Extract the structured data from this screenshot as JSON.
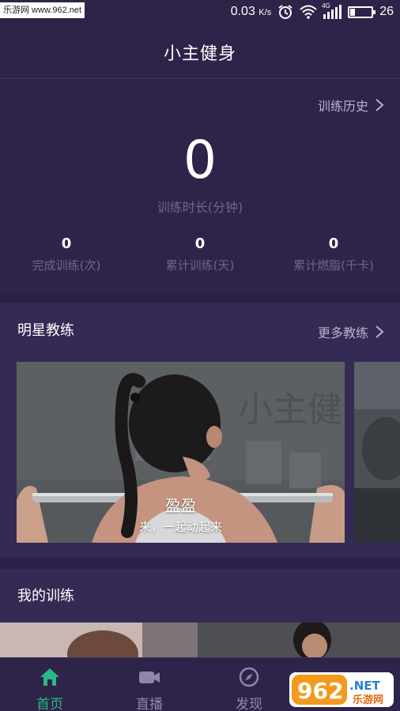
{
  "status_bar": {
    "watermark": "乐游网 www.962.net",
    "net_speed": "0.03",
    "net_speed_unit": "K/s",
    "network_type": "4G",
    "battery_level": "26",
    "icons": [
      "alarm-icon",
      "wifi-icon",
      "signal-icon",
      "battery-icon"
    ]
  },
  "header": {
    "title": "小主健身"
  },
  "stats": {
    "history_link": "训练历史",
    "total_minutes": "0",
    "total_minutes_label": "训练时长(分钟)",
    "metrics": [
      {
        "value": "0",
        "label": "完成训练(次)"
      },
      {
        "value": "0",
        "label": "累计训练(天)"
      },
      {
        "value": "0",
        "label": "累计燃脂(千卡)"
      }
    ]
  },
  "star_coaches": {
    "title": "明星教练",
    "more_link": "更多教练",
    "cards": [
      {
        "name": "盈盈",
        "tagline": "来，一起动起来",
        "background_text": "小主健"
      }
    ]
  },
  "my_training": {
    "title": "我的训练"
  },
  "tabbar": {
    "tabs": [
      {
        "label": "首页",
        "icon": "home-icon",
        "active": true
      },
      {
        "label": "直播",
        "icon": "video-camera-icon",
        "active": false
      },
      {
        "label": "发现",
        "icon": "compass-icon",
        "active": false
      }
    ]
  },
  "bottom_watermark": {
    "number": "962",
    "suffix": ".NET",
    "caption": "乐游网"
  },
  "colors": {
    "background": "#2b2046",
    "panel": "#2e2449",
    "section": "#352a54",
    "muted_text": "#6f668e",
    "link_text": "#b8b1cc",
    "accent_green": "#27b987"
  }
}
